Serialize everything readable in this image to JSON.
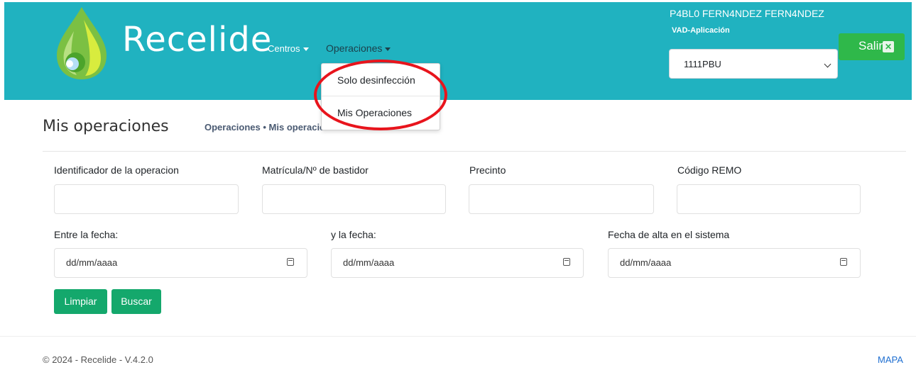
{
  "header": {
    "brand": "Recelide",
    "nav": {
      "centros": "Centros",
      "operaciones": "Operaciones"
    },
    "user_name": "P4BL0 FERN4NDEZ FERN4NDEZ",
    "app_name": "VAD-Aplicación",
    "center_select_value": "1111PBU",
    "logout_label": "Salir",
    "logout_icon": "close-icon",
    "colors": {
      "header_bg": "#20b2c0",
      "logout_bg": "#2fb84a"
    }
  },
  "dropdown": {
    "items": [
      {
        "label": "Solo desinfección"
      },
      {
        "label": "Mis Operaciones"
      }
    ],
    "highlight_color": "#e8141c"
  },
  "page": {
    "title": "Mis operaciones",
    "breadcrumb": "Operaciones • Mis operaciones"
  },
  "form": {
    "id_label": "Identificador de la operacion",
    "matricula_label": "Matrícula/Nº de bastidor",
    "precinto_label": "Precinto",
    "remo_label": "Código REMO",
    "fecha_desde_label": "Entre la fecha:",
    "fecha_hasta_label": "y la fecha:",
    "fecha_alta_label": "Fecha de alta en el sistema",
    "date_placeholder": "dd/mm/aaaa",
    "clear_label": "Limpiar",
    "search_label": "Buscar",
    "button_color": "#14a86c"
  },
  "footer": {
    "copyright": "© 2024 - Recelide - V.4.2.0",
    "map_link": "MAPA"
  }
}
